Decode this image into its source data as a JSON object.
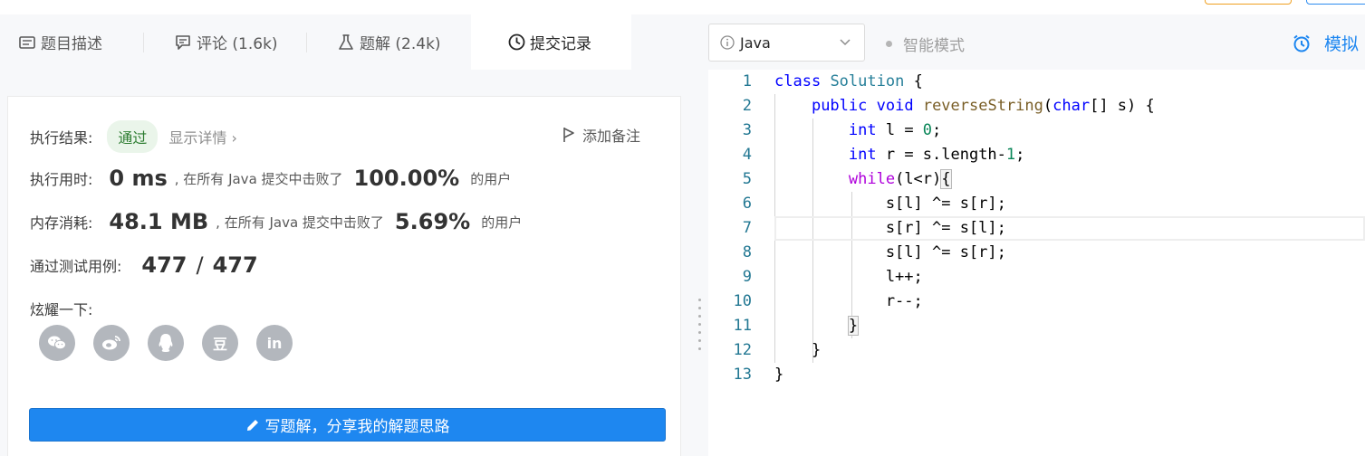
{
  "tabs": [
    {
      "label": "题目描述",
      "icon": "description-icon"
    },
    {
      "label": "评论 (1.6k)",
      "icon": "comment-icon"
    },
    {
      "label": "题解 (2.4k)",
      "icon": "flask-icon"
    },
    {
      "label": "提交记录",
      "icon": "clock-icon"
    }
  ],
  "result": {
    "label": "执行结果:",
    "status": "通过",
    "details": "显示详情 ›",
    "add_note": "添加备注"
  },
  "runtime": {
    "label": "执行用时:",
    "value": "0 ms",
    "beat_text": ", 在所有 Java 提交中击败了",
    "percent": "100.00%",
    "suffix": "的用户"
  },
  "memory": {
    "label": "内存消耗:",
    "value": "48.1 MB",
    "beat_text": ", 在所有 Java 提交中击败了",
    "percent": "5.69%",
    "suffix": "的用户"
  },
  "tests": {
    "label": "通过测试用例:",
    "passed": "477",
    "sep": "/",
    "total": "477"
  },
  "share": {
    "label": "炫耀一下:",
    "icons": [
      "wechat-icon",
      "weibo-icon",
      "qq-icon",
      "douban-icon",
      "linkedin-icon"
    ],
    "douban_glyph": "豆",
    "linkedin_glyph": "in"
  },
  "write_button": "写题解，分享我的解题思路",
  "editor": {
    "language": "Java",
    "smart_mode": "智能模式",
    "mock_label": "模拟"
  },
  "code_lines": [
    {
      "n": "1",
      "text": "class Solution {"
    },
    {
      "n": "2",
      "text": "    public void reverseString(char[] s) {"
    },
    {
      "n": "3",
      "text": "        int l = 0;"
    },
    {
      "n": "4",
      "text": "        int r = s.length-1;"
    },
    {
      "n": "5",
      "text": "        while(l<r){"
    },
    {
      "n": "6",
      "text": "            s[l] ^= s[r];"
    },
    {
      "n": "7",
      "text": "            s[r] ^= s[l];"
    },
    {
      "n": "8",
      "text": "            s[l] ^= s[r];"
    },
    {
      "n": "9",
      "text": "            l++;"
    },
    {
      "n": "10",
      "text": "            r--;"
    },
    {
      "n": "11",
      "text": "        }"
    },
    {
      "n": "12",
      "text": "    }"
    },
    {
      "n": "13",
      "text": "}"
    }
  ],
  "colors": {
    "accent": "#1e87f0",
    "pass_bg": "#eaf5ea",
    "pass_text": "#2e7d32",
    "line_number": "#237893"
  }
}
